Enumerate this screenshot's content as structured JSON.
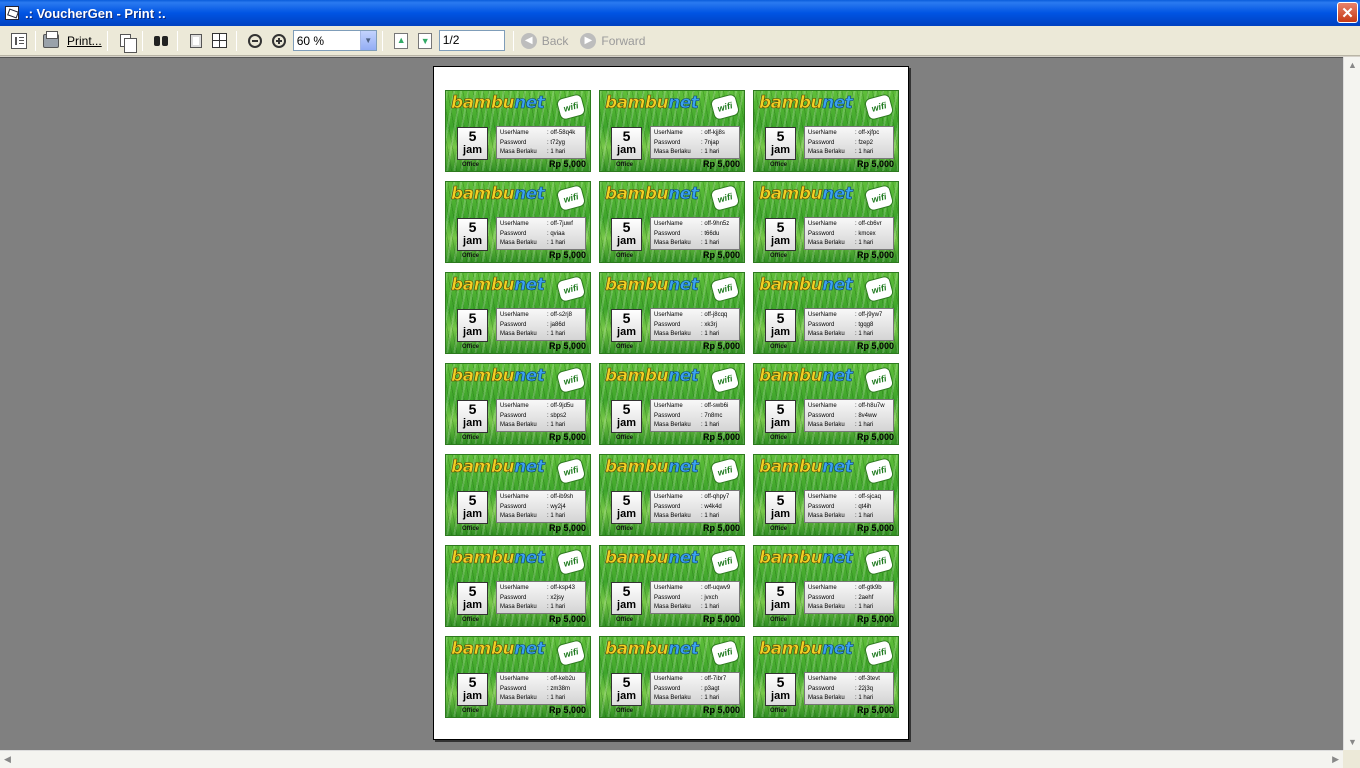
{
  "window": {
    "title": ".: VoucherGen - Print :."
  },
  "toolbar": {
    "print_label": "Print...",
    "zoom_value": "60 %",
    "page_value": "1/2",
    "back_label": "Back",
    "forward_label": "Forward"
  },
  "voucher_template": {
    "brand_a": "bambu",
    "brand_b": "net",
    "badge": "wifi",
    "hours_num": "5",
    "hours_unit": "jam",
    "user_label": "UserName",
    "pass_label": "Password",
    "valid_label": "Masa Berlaku",
    "valid_value": ": 1 hari",
    "location": "Office",
    "price": "Rp 5,000"
  },
  "vouchers": [
    {
      "username": ": off-58q4k",
      "password": ": t72yg"
    },
    {
      "username": ": off-kjj8s",
      "password": ": 7njap"
    },
    {
      "username": ": off-xjfpc",
      "password": ": fzep2"
    },
    {
      "username": ": off-7juwf",
      "password": ": qviaa"
    },
    {
      "username": ": off-9hn5z",
      "password": ": t66du"
    },
    {
      "username": ": off-cb6vr",
      "password": ": kmcex"
    },
    {
      "username": ": off-s2rj8",
      "password": ": ja86d"
    },
    {
      "username": ": off-j8cqq",
      "password": ": xk3rj"
    },
    {
      "username": ": off-j9yw7",
      "password": ": tgqg8"
    },
    {
      "username": ": off-9jd5u",
      "password": ": sbps2"
    },
    {
      "username": ": off-swb6i",
      "password": ": 7n8mc"
    },
    {
      "username": ": off-h8u7w",
      "password": ": 8v4ww"
    },
    {
      "username": ": off-ib9sh",
      "password": ": wy2j4"
    },
    {
      "username": ": off-qhpy7",
      "password": ": w4k4d"
    },
    {
      "username": ": off-sjcaq",
      "password": ": qt4ih"
    },
    {
      "username": ": off-ksp43",
      "password": ": x2jsy"
    },
    {
      "username": ": off-uqwv9",
      "password": ": jvxch"
    },
    {
      "username": ": off-gtk9b",
      "password": ": 2aehf"
    },
    {
      "username": ": off-keb2u",
      "password": ": zm38m"
    },
    {
      "username": ": off-7ibr7",
      "password": ": p3agt"
    },
    {
      "username": ": off-3tevt",
      "password": ": 22j3q"
    }
  ]
}
